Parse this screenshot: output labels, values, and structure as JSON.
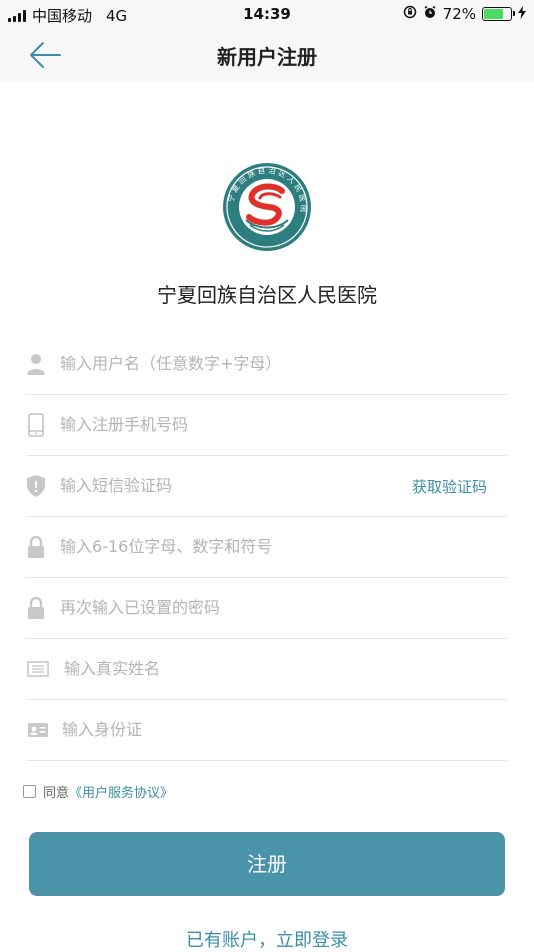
{
  "status_bar": {
    "carrier": "中国移动",
    "network": "4G",
    "time": "14:39",
    "battery_percent": "72%",
    "battery_level": 0.72
  },
  "nav": {
    "title": "新用户注册",
    "back_icon": "arrow-left-icon"
  },
  "hospital": {
    "name": "宁夏回族自治区人民医院",
    "logo_ring_text": "宁夏回族自治区人民医院",
    "logo_sub_text": "People's Hospital of Ningxia Hui Autonomous Region"
  },
  "form": {
    "username_placeholder": "输入用户名（任意数字+字母）",
    "phone_placeholder": "输入注册手机号码",
    "sms_placeholder": "输入短信验证码",
    "get_code_label": "获取验证码",
    "password_placeholder": "输入6-16位字母、数字和符号",
    "confirm_password_placeholder": "再次输入已设置的密码",
    "real_name_placeholder": "输入真实姓名",
    "id_card_placeholder": "输入身份证"
  },
  "agreement": {
    "prefix": "同意",
    "link": "《用户服务协议》",
    "checked": false
  },
  "register_label": "注册",
  "login_link": "已有账户，立即登录",
  "colors": {
    "accent": "#3a8fa8",
    "button": "#4a93a9",
    "logo_teal": "#2c7e80",
    "logo_red": "#e0302a"
  }
}
